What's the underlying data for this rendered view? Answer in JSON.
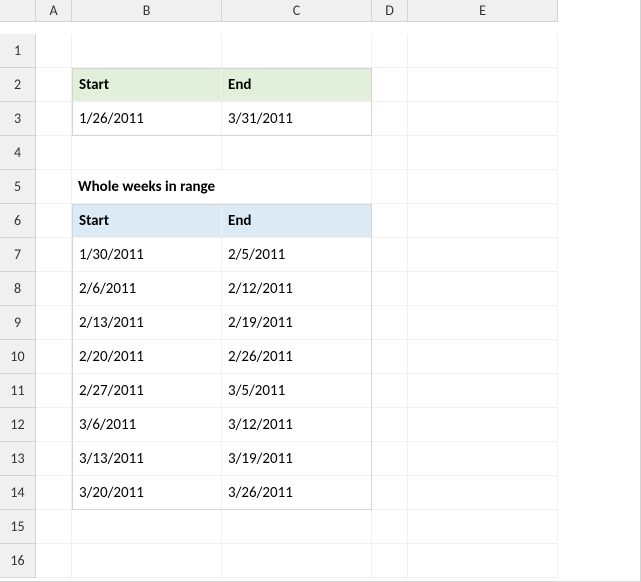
{
  "columns": [
    "A",
    "B",
    "C",
    "D",
    "E"
  ],
  "rows": [
    "1",
    "2",
    "3",
    "4",
    "5",
    "6",
    "7",
    "8",
    "9",
    "10",
    "11",
    "12",
    "13",
    "14",
    "15",
    "16"
  ],
  "range_header": {
    "start": "Start",
    "end": "End"
  },
  "range_values": {
    "start": "1/26/2011",
    "end": "3/31/2011"
  },
  "section_title": "Whole weeks in range",
  "weeks_header": {
    "start": "Start",
    "end": "End"
  },
  "weeks": [
    {
      "start": "1/30/2011",
      "end": "2/5/2011"
    },
    {
      "start": "2/6/2011",
      "end": "2/12/2011"
    },
    {
      "start": "2/13/2011",
      "end": "2/19/2011"
    },
    {
      "start": "2/20/2011",
      "end": "2/26/2011"
    },
    {
      "start": "2/27/2011",
      "end": "3/5/2011"
    },
    {
      "start": "3/6/2011",
      "end": "3/12/2011"
    },
    {
      "start": "3/13/2011",
      "end": "3/19/2011"
    },
    {
      "start": "3/20/2011",
      "end": "3/26/2011"
    }
  ]
}
